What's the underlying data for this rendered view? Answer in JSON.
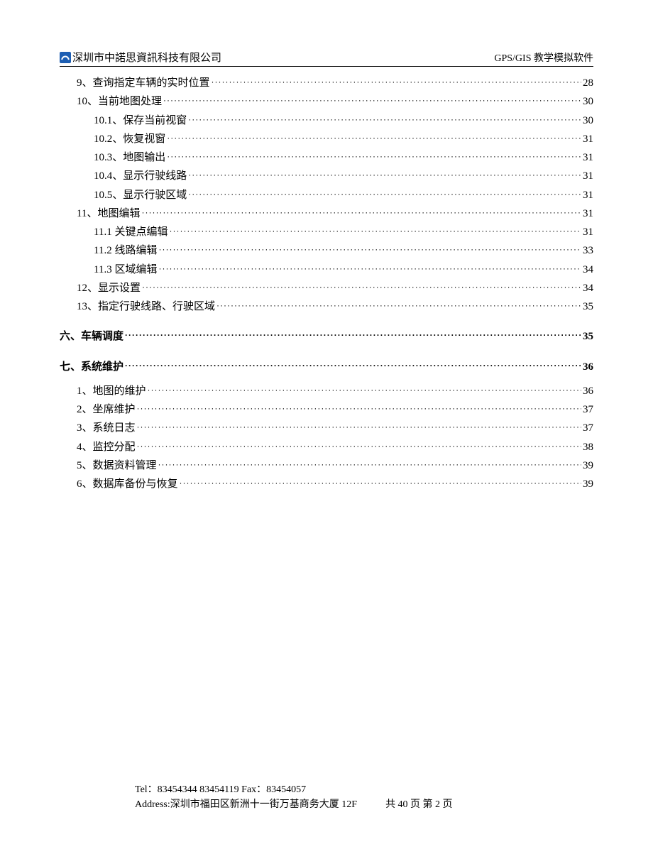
{
  "header": {
    "company": "深圳市中諾思資訊科技有限公司",
    "doc_title": "GPS/GIS 教学模拟软件"
  },
  "toc": [
    {
      "level": 1,
      "label": "9、查询指定车辆的实时位置",
      "page": "28"
    },
    {
      "level": 1,
      "label": "10、当前地图处理",
      "page": "30"
    },
    {
      "level": 2,
      "label": "10.1、保存当前视窗",
      "page": "30"
    },
    {
      "level": 2,
      "label": "10.2、恢复视窗",
      "page": "31"
    },
    {
      "level": 2,
      "label": "10.3、地图输出",
      "page": "31"
    },
    {
      "level": 2,
      "label": "10.4、显示行驶线路",
      "page": "31"
    },
    {
      "level": 2,
      "label": "10.5、显示行驶区域",
      "page": "31"
    },
    {
      "level": 1,
      "label": "11、地图编辑",
      "page": "31"
    },
    {
      "level": 2,
      "label": "11.1 关键点编辑",
      "page": "31"
    },
    {
      "level": 2,
      "label": "11.2 线路编辑",
      "page": "33"
    },
    {
      "level": 2,
      "label": "11.3 区域编辑",
      "page": "34"
    },
    {
      "level": 1,
      "label": "12、显示设置",
      "page": "34"
    },
    {
      "level": 1,
      "label": "13、指定行驶线路、行驶区域",
      "page": "35"
    }
  ],
  "heading1": {
    "label": "六、车辆调度",
    "page": "35"
  },
  "heading2": {
    "label": "七、系统维护",
    "page": "36"
  },
  "toc2": [
    {
      "level": 1,
      "label": "1、地图的维护",
      "page": "36"
    },
    {
      "level": 1,
      "label": "2、坐席维护",
      "page": "37"
    },
    {
      "level": 1,
      "label": "3、系统日志",
      "page": "37"
    },
    {
      "level": 1,
      "label": "4、监控分配",
      "page": "38"
    },
    {
      "level": 1,
      "label": "5、数据资料管理",
      "page": "39"
    },
    {
      "level": 1,
      "label": "6、数据库备份与恢复",
      "page": "39"
    }
  ],
  "footer": {
    "tel": "Tel：83454344 83454119 Fax：83454057",
    "address": "Address:深圳市福田区新洲十一街万基商务大厦 12F",
    "pages": "共 40 页   第 2 页"
  }
}
